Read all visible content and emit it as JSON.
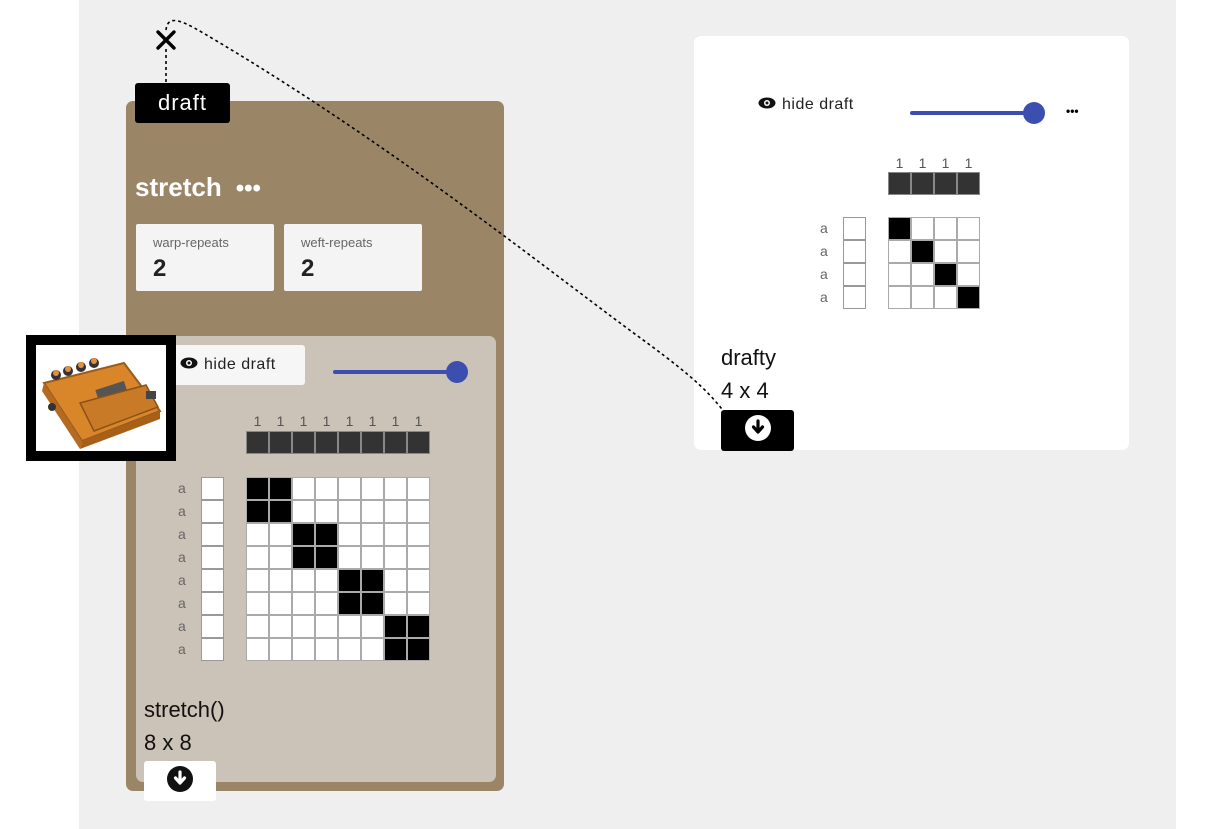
{
  "operation": {
    "tag_label": "draft",
    "title": "stretch",
    "menu_dots": "•••",
    "params": [
      {
        "label": "warp-repeats",
        "value": "2"
      },
      {
        "label": "weft-repeats",
        "value": "2"
      }
    ],
    "output": {
      "hide_label": "hide draft",
      "slider_value": 1.0,
      "warp_numbers": [
        "1",
        "1",
        "1",
        "1",
        "1",
        "1",
        "1",
        "1"
      ],
      "weft_labels": [
        "a",
        "a",
        "a",
        "a",
        "a",
        "a",
        "a",
        "a"
      ],
      "grid": [
        [
          1,
          1,
          0,
          0,
          0,
          0,
          0,
          0
        ],
        [
          1,
          1,
          0,
          0,
          0,
          0,
          0,
          0
        ],
        [
          0,
          0,
          1,
          1,
          0,
          0,
          0,
          0
        ],
        [
          0,
          0,
          1,
          1,
          0,
          0,
          0,
          0
        ],
        [
          0,
          0,
          0,
          0,
          1,
          1,
          0,
          0
        ],
        [
          0,
          0,
          0,
          0,
          1,
          1,
          0,
          0
        ],
        [
          0,
          0,
          0,
          0,
          0,
          0,
          1,
          1
        ],
        [
          0,
          0,
          0,
          0,
          0,
          0,
          1,
          1
        ]
      ],
      "name": "stretch()",
      "size": "8 x 8",
      "download_icon": "download-circle-icon"
    },
    "image_thumbnail": "guitar-pedal-image"
  },
  "draft_node": {
    "hide_label": "hide draft",
    "slider_value": 1.0,
    "menu_dots": "•••",
    "warp_numbers": [
      "1",
      "1",
      "1",
      "1"
    ],
    "weft_labels": [
      "a",
      "a",
      "a",
      "a"
    ],
    "grid": [
      [
        1,
        0,
        0,
        0
      ],
      [
        0,
        1,
        0,
        0
      ],
      [
        0,
        0,
        1,
        0
      ],
      [
        0,
        0,
        0,
        1
      ]
    ],
    "name": "drafty",
    "size": "4 x 4",
    "download_icon": "download-circle-icon"
  },
  "connection": {
    "remove_icon": "close-icon"
  },
  "colors": {
    "canvas": "#efefef",
    "operation_card": "#9a8667",
    "output_panel": "#cbc3b8",
    "slider": "#3c4fb0",
    "warp_bar": "#333333",
    "cell_on": "#000000"
  }
}
